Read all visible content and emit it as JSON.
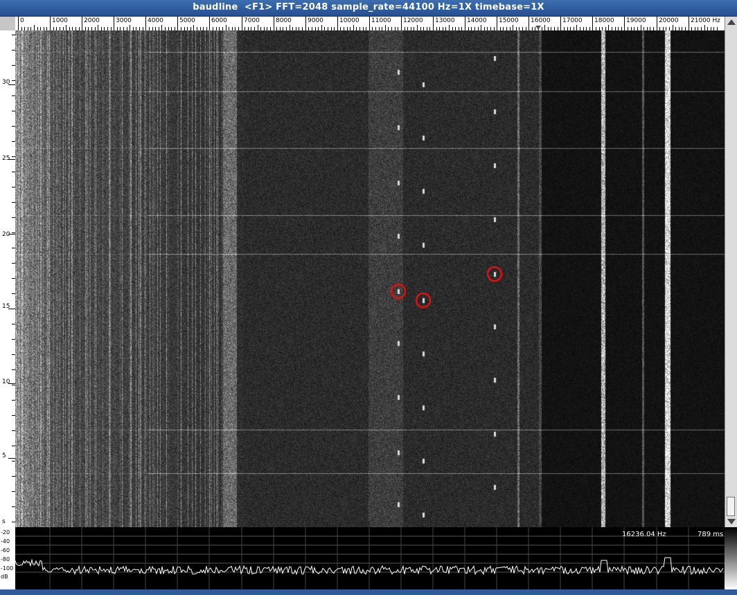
{
  "window": {
    "title": "baudline  <F1> FFT=2048 sample_rate=44100 Hz=1X timebase=1X"
  },
  "freq_axis": {
    "labels": [
      "0",
      "1000",
      "2000",
      "3000",
      "4000",
      "5000",
      "6000",
      "7000",
      "8000",
      "9000",
      "10000",
      "11000",
      "12000",
      "13000",
      "14000",
      "15000",
      "16000",
      "17000",
      "18000",
      "19000",
      "20000",
      "21000 Hz"
    ],
    "max_hz": 22050
  },
  "time_axis": {
    "labels": [
      "30",
      "25",
      "20",
      "15",
      "10",
      "5",
      "s"
    ]
  },
  "db_axis": {
    "labels": [
      "-20",
      "-40",
      "-60",
      "-80",
      "-100",
      "dB"
    ]
  },
  "readout": {
    "frequency": "16236.04 Hz",
    "time": "789 ms"
  },
  "markers": {
    "count": 3,
    "color": "#dd1111"
  },
  "colors": {
    "titlebar": "#2f5b9a",
    "trace": "#ffffff"
  },
  "icons": {
    "scroll_up": "triangle-up-icon",
    "scroll_down": "triangle-down-icon",
    "cursor": "triangle-down-marker-icon"
  }
}
